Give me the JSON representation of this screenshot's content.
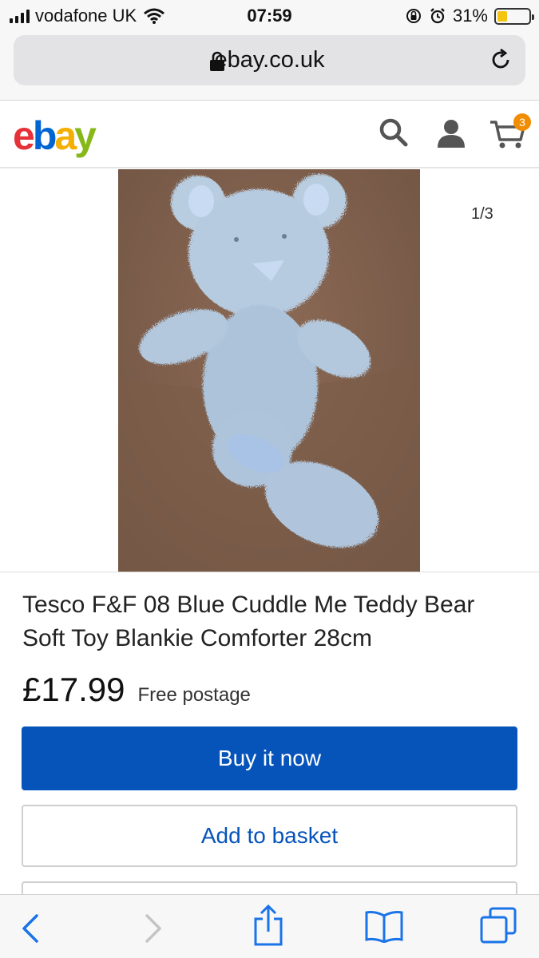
{
  "status_bar": {
    "carrier": "vodafone UK",
    "time": "07:59",
    "battery_percent": "31%",
    "battery_level": 0.31,
    "icons": [
      "signal-icon",
      "wifi-icon",
      "rotation-lock-icon",
      "alarm-icon",
      "battery-icon"
    ]
  },
  "browser": {
    "url": "ebay.co.uk",
    "icons": [
      "lock-icon",
      "reload-icon"
    ],
    "toolbar_icons": [
      "back-icon",
      "forward-icon",
      "share-icon",
      "bookmarks-icon",
      "tabs-icon"
    ]
  },
  "header": {
    "logo_letters": [
      "e",
      "b",
      "a",
      "y"
    ],
    "icons": [
      "search-icon",
      "user-icon",
      "cart-icon"
    ],
    "cart_count": "3",
    "colors": {
      "e": "#e53238",
      "b": "#0064d2",
      "a": "#f5af02",
      "y": "#86b817"
    }
  },
  "gallery": {
    "counter": "1/3",
    "image_subject": "light blue fluffy teddy bear on brown background"
  },
  "product": {
    "title": "Tesco F&F 08 Blue Cuddle Me Teddy Bear Soft Toy Blankie Comforter 28cm",
    "price": "£17.99",
    "postage": "Free postage"
  },
  "actions": {
    "buy_now": "Buy it now",
    "add_to_basket": "Add to basket"
  },
  "colors": {
    "primary_button": "#0654ba",
    "cart_badge": "#f18d00"
  }
}
